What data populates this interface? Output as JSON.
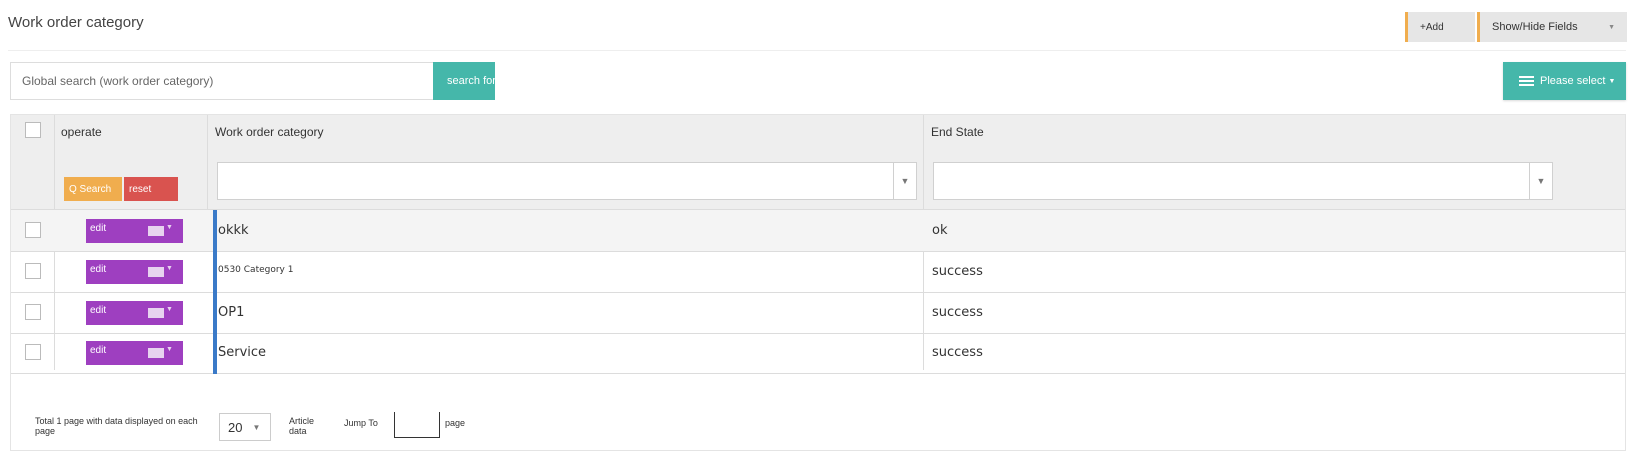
{
  "header": {
    "title": "Work order category",
    "add_label": "+Add",
    "fields_label": "Show/Hide Fields"
  },
  "search": {
    "placeholder": "Global search (work order category)",
    "button_label": "search for",
    "select_label": "Please select"
  },
  "table": {
    "columns": {
      "operate": "operate",
      "category": "Work order category",
      "end_state": "End State"
    },
    "filter_buttons": {
      "search": "Q Search",
      "reset": "reset"
    },
    "edit_label": "edit",
    "rows": [
      {
        "category": "okkk",
        "end_state": "ok"
      },
      {
        "category": "0530 Category 1",
        "end_state": "success"
      },
      {
        "category": "OP1",
        "end_state": "success"
      },
      {
        "category": "Service",
        "end_state": "success"
      }
    ]
  },
  "pagination": {
    "summary": "Total 1 page with data displayed on each page",
    "page_size": "20",
    "unit": "Article data",
    "jump_label": "Jump To",
    "page_label": "page"
  },
  "colors": {
    "teal": "#45b7aa",
    "orange": "#f0ad4e",
    "red": "#d9534f",
    "purple": "#9e3fc0",
    "blue_accent": "#3a7ac8"
  },
  "icons": [
    "list-icon",
    "chevron-down-icon",
    "checkbox-icon"
  ]
}
